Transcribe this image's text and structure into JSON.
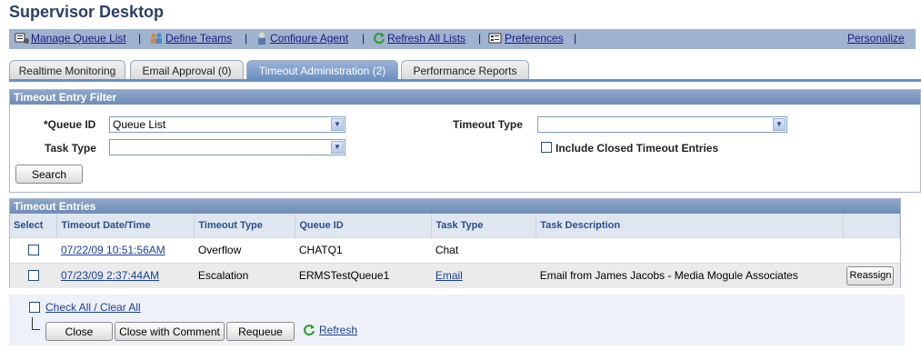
{
  "page": {
    "title": "Supervisor Desktop"
  },
  "nav": {
    "items": [
      {
        "label": "Manage Queue List",
        "icon": "queue-list-icon"
      },
      {
        "label": "Define Teams",
        "icon": "teams-icon"
      },
      {
        "label": "Configure Agent",
        "icon": "agent-icon"
      },
      {
        "label": "Refresh All Lists",
        "icon": "refresh-icon"
      },
      {
        "label": "Preferences",
        "icon": "preferences-icon"
      }
    ],
    "personalize": "Personalize"
  },
  "tabs": [
    {
      "label": "Realtime Monitoring",
      "active": false
    },
    {
      "label": "Email Approval (0)",
      "active": false
    },
    {
      "label": "Timeout Administration (2)",
      "active": true
    },
    {
      "label": "Performance Reports",
      "active": false
    }
  ],
  "filter": {
    "header": "Timeout Entry Filter",
    "queue_id_label": "*Queue ID",
    "queue_id_value": "Queue List",
    "task_type_label": "Task Type",
    "task_type_value": "",
    "timeout_type_label": "Timeout Type",
    "timeout_type_value": "",
    "include_closed_label": "Include Closed Timeout Entries",
    "search_label": "Search"
  },
  "entries": {
    "header": "Timeout Entries",
    "columns": [
      "Select",
      "Timeout Date/Time",
      "Timeout Type",
      "Queue ID",
      "Task Type",
      "Task Description"
    ],
    "rows": [
      {
        "datetime": "07/22/09 10:51:56AM",
        "timeout_type": "Overflow",
        "queue_id": "CHATQ1",
        "task_type": "Chat",
        "description": "",
        "action": ""
      },
      {
        "datetime": "07/23/09 2:37:44AM",
        "timeout_type": "Escalation",
        "queue_id": "ERMSTestQueue1",
        "task_type": "Email",
        "description": "Email from James Jacobs - Media Mogule Associates",
        "action": "Reassign"
      }
    ]
  },
  "footer": {
    "check_all": "Check All / Clear All",
    "close": "Close",
    "close_with_comment": "Close with Comment",
    "requeue": "Requeue",
    "refresh": "Refresh"
  },
  "colors": {
    "title": "#2a3f67",
    "nav_bg": "#9fb3cf",
    "header_bg": "#6f8db9",
    "link": "#1a3f9b"
  }
}
